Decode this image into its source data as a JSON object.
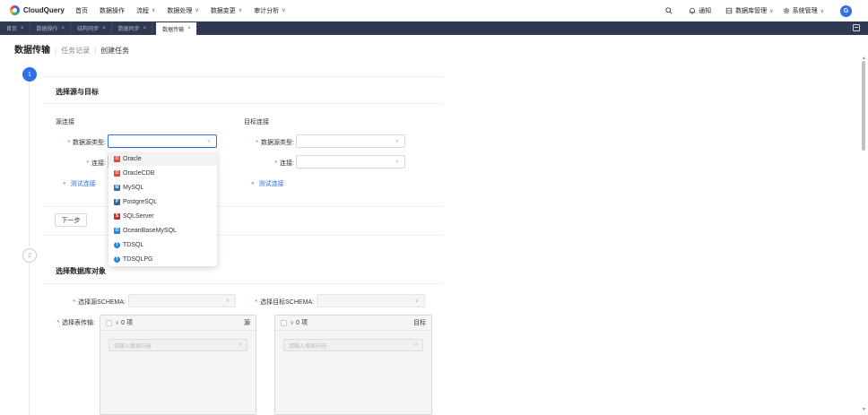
{
  "nav": {
    "logo_text": "CloudQuery",
    "items": [
      {
        "label": "首页",
        "has_menu": false,
        "active": false
      },
      {
        "label": "数据操作",
        "has_menu": false,
        "active": false
      },
      {
        "label": "流程",
        "has_menu": true,
        "active": false
      },
      {
        "label": "数据处理",
        "has_menu": true,
        "active": true
      },
      {
        "label": "数据变更",
        "has_menu": true,
        "active": false
      },
      {
        "label": "审计分析",
        "has_menu": true,
        "active": false
      }
    ],
    "notify_label": "通知",
    "db_manage_label": "数据库管理",
    "sys_manage_label": "系统管理",
    "avatar_letter": "G",
    "chevron": "∨"
  },
  "tabs": [
    {
      "label": "首页",
      "active": false
    },
    {
      "label": "数据操作",
      "active": false
    },
    {
      "label": "结构同步",
      "active": false
    },
    {
      "label": "数据同步",
      "active": false
    },
    {
      "label": "数据传输",
      "active": true
    }
  ],
  "breadcrumb": {
    "main": "数据传输",
    "items": [
      "任务记录",
      "创建任务"
    ]
  },
  "steps": {
    "step1": "1",
    "step2": "2"
  },
  "section1": {
    "title": "选择源与目标",
    "source_head": "源连接",
    "target_head": "目标连接",
    "source_type_label": "数据源类型:",
    "source_conn_label": "连接:",
    "target_type_label": "数据源类型:",
    "target_conn_label": "连接:",
    "test_conn_label": "测试连接",
    "next_button": "下一步"
  },
  "dropdown": {
    "options": [
      {
        "label": "Oracle",
        "icon": "oracle-icon",
        "color": "#e8453c"
      },
      {
        "label": "OracleCDB",
        "icon": "oracle-icon",
        "color": "#e8453c"
      },
      {
        "label": "MySQL",
        "icon": "mysql-icon",
        "color": "#3a6ea5"
      },
      {
        "label": "PostgreSQL",
        "icon": "postgresql-icon",
        "color": "#336791"
      },
      {
        "label": "SQLServer",
        "icon": "sqlserver-icon",
        "color": "#c4302b"
      },
      {
        "label": "OceanBaseMySQL",
        "icon": "oceanbase-icon",
        "color": "#1e88e5"
      },
      {
        "label": "TDSQL",
        "icon": "tdsql-icon",
        "color": "#1e88e5"
      },
      {
        "label": "TDSQLPG",
        "icon": "tdsqlpg-icon",
        "color": "#1e88e5"
      }
    ]
  },
  "section2": {
    "title": "选择数据库对象",
    "source_schema_label": "选择源SCHEMA:",
    "target_schema_label": "选择目标SCHEMA:",
    "table_transfer_label": "选择表传输:",
    "left_count": "0 项",
    "left_tag": "源",
    "right_count": "0 项",
    "right_tag": "目标",
    "search_placeholder": "请输入搜索内容"
  }
}
